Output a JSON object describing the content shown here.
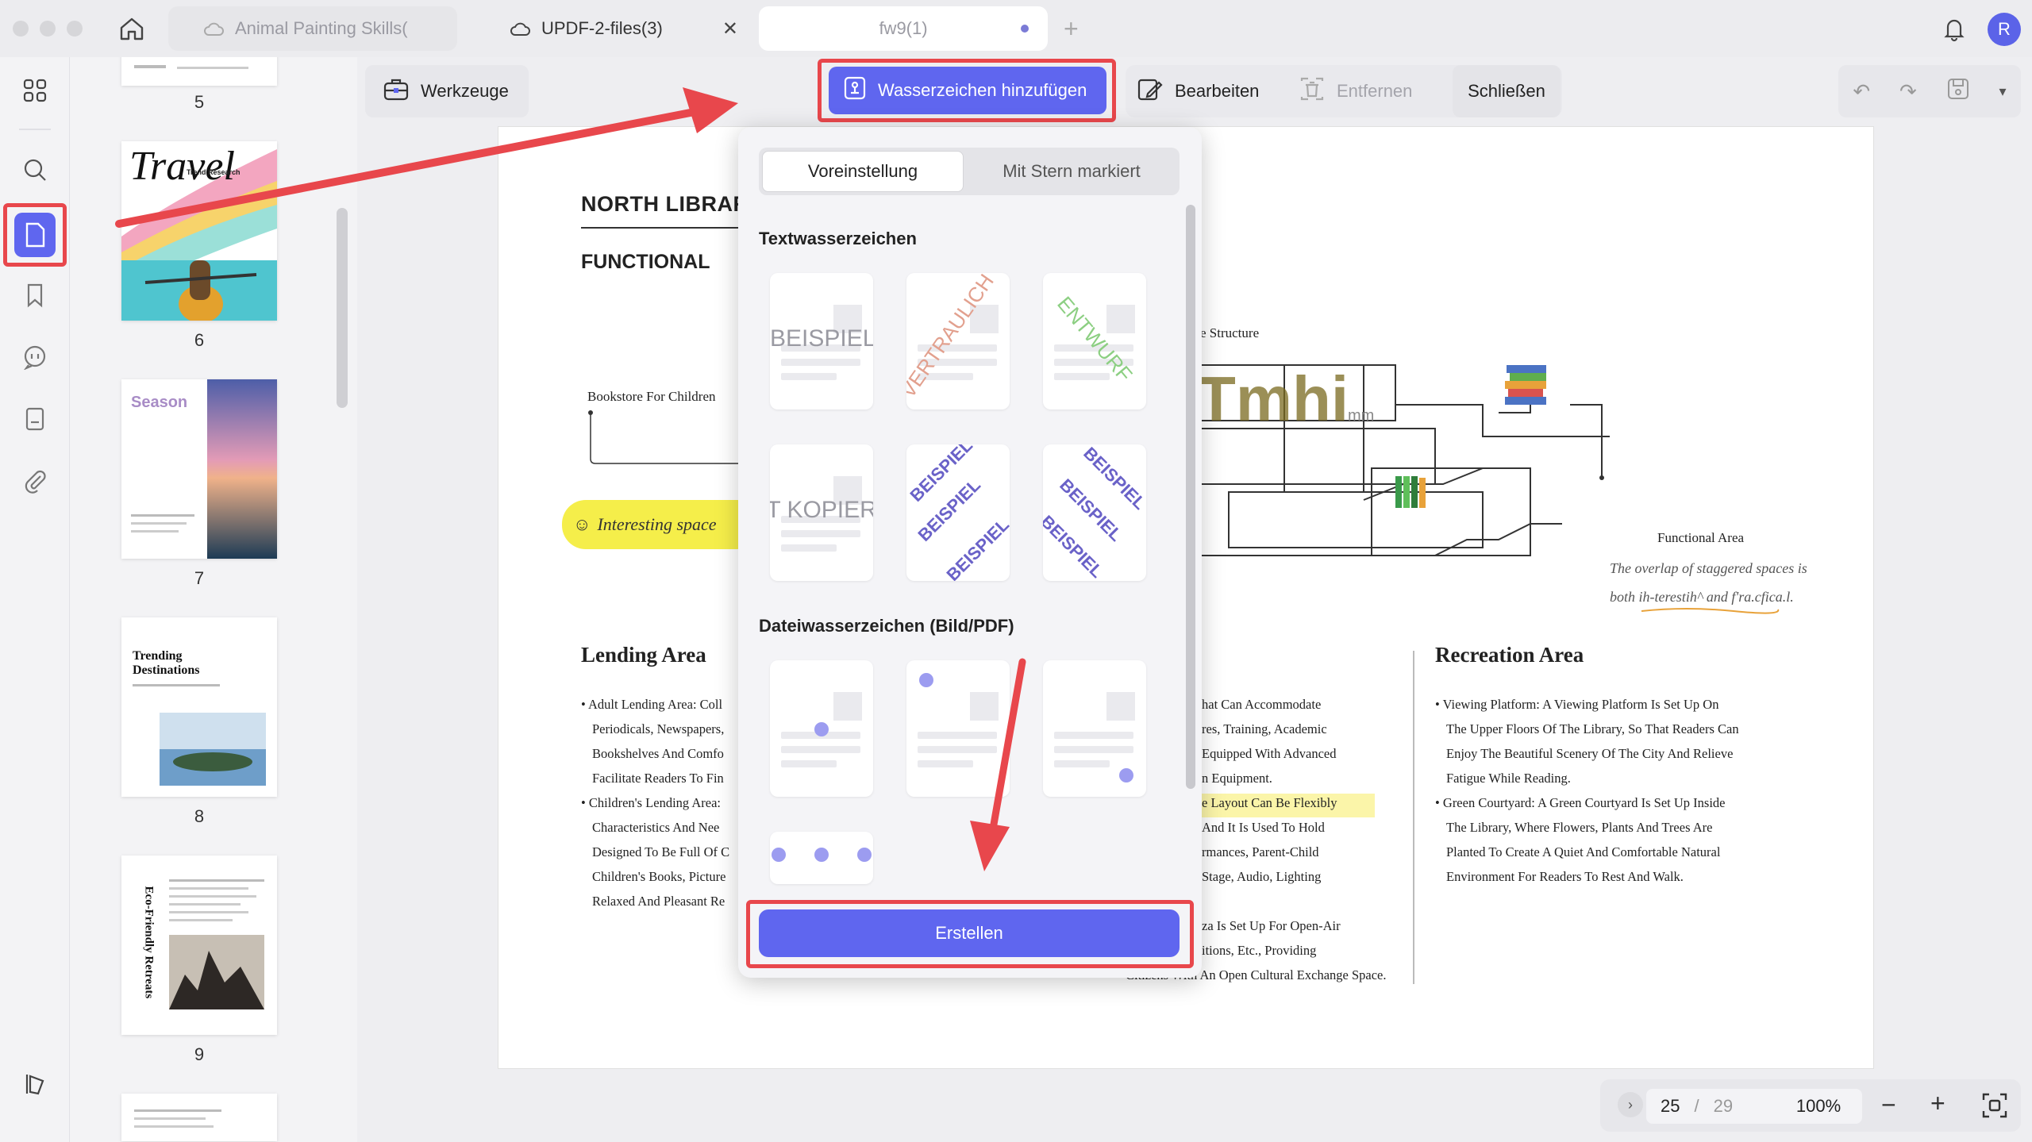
{
  "window": {
    "tabs": [
      {
        "label": "Animal Painting Skills("
      },
      {
        "label": "UPDF-2-files(3)"
      },
      {
        "label": "fw9(1)"
      }
    ],
    "avatar_initial": "R"
  },
  "thumbnails": {
    "page_numbers": [
      "5",
      "6",
      "7",
      "8",
      "9"
    ],
    "travel_title": "Travel",
    "travel_sub": "Trend Research",
    "season_title": "Season",
    "trending_title": "Trending Destinations",
    "eco_title": "Eco-Friendly Retreats"
  },
  "toolbar": {
    "tools_label": "Werkzeuge",
    "watermark_label": "Wasserzeichen hinzufügen",
    "edit_label": "Bearbeiten",
    "remove_label": "Entfernen",
    "close_label": "Schließen"
  },
  "popup": {
    "tab_preset": "Voreinstellung",
    "tab_starred": "Mit Stern markiert",
    "text_watermarks_heading": "Textwasserzeichen",
    "file_watermarks_heading": "Dateiwasserzeichen (Bild/PDF)",
    "samples": {
      "beispiel": "BEISPIEL",
      "vertraulich": "VERTRAULICH",
      "entwurf": "ENTWURF",
      "kopie": "NICHT KOPIEREN",
      "beispiel_tile": "BEISPIEL"
    },
    "create_label": "Erstellen"
  },
  "document": {
    "heading": "NORTH LIBRARY",
    "subheading": "FUNCTIONAL",
    "bookstore_label": "Bookstore For Children",
    "structure_label": "e Structure",
    "functional_area_label": "Functional Area",
    "annotation_line1": "The overlap of staggered spaces is",
    "annotation_line2": "both ih-terestih^ and f'ra.cfica.l.",
    "interesting_label": "Interesting space",
    "lending_title": "Lending Area",
    "lending_lines": [
      "• Adult Lending Area: Coll",
      "Periodicals, Newspapers,",
      "Bookshelves And Comfo",
      "Facilitate Readers To Fin",
      "• Children's Lending Area:",
      "Characteristics And Nee",
      "Designed To Be Full Of C",
      "Children's Books, Picture",
      "Relaxed And Pleasant Re"
    ],
    "middle_lines": [
      "hat Can Accommodate",
      "res, Training, Academic",
      "Equipped With Advanced",
      "n Equipment.",
      "e Layout Can Be Flexibly",
      "And It Is Used To Hold",
      "rmances, Parent-Child",
      "Stage, Audio, Lighting",
      "",
      "za Is Set Up For Open-Air",
      "itions, Etc., Providing",
      "Citizens With An Open Cultural Exchange Space."
    ],
    "recreation_title": "Recreation Area",
    "recreation_lines": [
      "• Viewing Platform: A Viewing Platform Is Set Up On",
      "The Upper Floors Of The Library, So That Readers Can",
      "Enjoy The Beautiful Scenery Of The City And Relieve",
      "Fatigue While Reading.",
      "• Green Courtyard: A Green Courtyard Is Set Up Inside",
      "The Library, Where Flowers, Plants And Trees Are",
      "Planted To Create A Quiet And Comfortable Natural",
      "Environment For Readers To Rest And Walk."
    ],
    "drawing_text": "Tmhi",
    "drawing_sub": "mm"
  },
  "footer": {
    "current_page": "25",
    "separator": "/",
    "total_pages": "29",
    "zoom": "100%"
  },
  "colors": {
    "accent": "#5f66ef",
    "highlight_red": "#e8474c"
  }
}
